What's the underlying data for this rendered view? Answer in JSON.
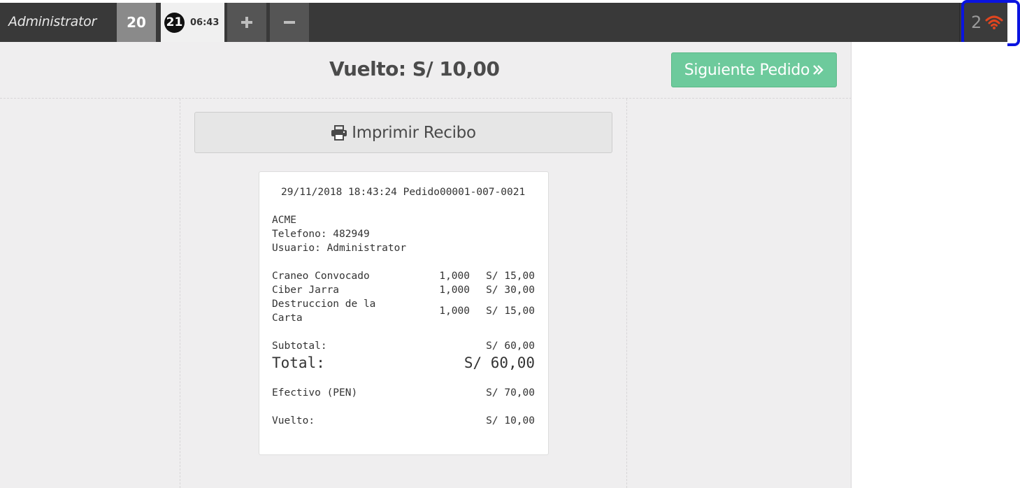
{
  "topbar": {
    "user": "Administrator",
    "tabs": [
      {
        "number": "20"
      },
      {
        "number": "21",
        "time": "06:43"
      }
    ],
    "add_icon": "plus-icon",
    "remove_icon": "minus-icon",
    "status_count": "2",
    "status_icon": "wifi-icon",
    "status_color": "#e0451f"
  },
  "main": {
    "change_title": "Vuelto: S/ 10,00",
    "next_button": "Siguiente Pedido",
    "next_icon": "double-chevron-right-icon",
    "print_button": "Imprimir Recibo",
    "print_icon": "printer-icon"
  },
  "receipt": {
    "header": "29/11/2018 18:43:24 Pedido00001-007-0021",
    "company": "ACME",
    "phone": "Telefono: 482949",
    "user": "Usuario: Administrator",
    "items": [
      {
        "name": "Craneo Convocado",
        "qty": "1,000",
        "price": "S/ 15,00"
      },
      {
        "name": "Ciber Jarra",
        "qty": "1,000",
        "price": "S/ 30,00"
      },
      {
        "name_line1": "Destruccion de la",
        "name_line2": "Carta",
        "qty": "1,000",
        "price": "S/ 15,00"
      }
    ],
    "subtotal_label": "Subtotal:",
    "subtotal_value": "S/ 60,00",
    "total_label": "Total:",
    "total_value": "S/ 60,00",
    "cash_label": "Efectivo (PEN)",
    "cash_value": "S/ 70,00",
    "change_label": "Vuelto:",
    "change_value": "S/ 10,00"
  },
  "colors": {
    "topbar": "#393939",
    "success": "#6dca9c",
    "highlight": "#0a14e0"
  }
}
